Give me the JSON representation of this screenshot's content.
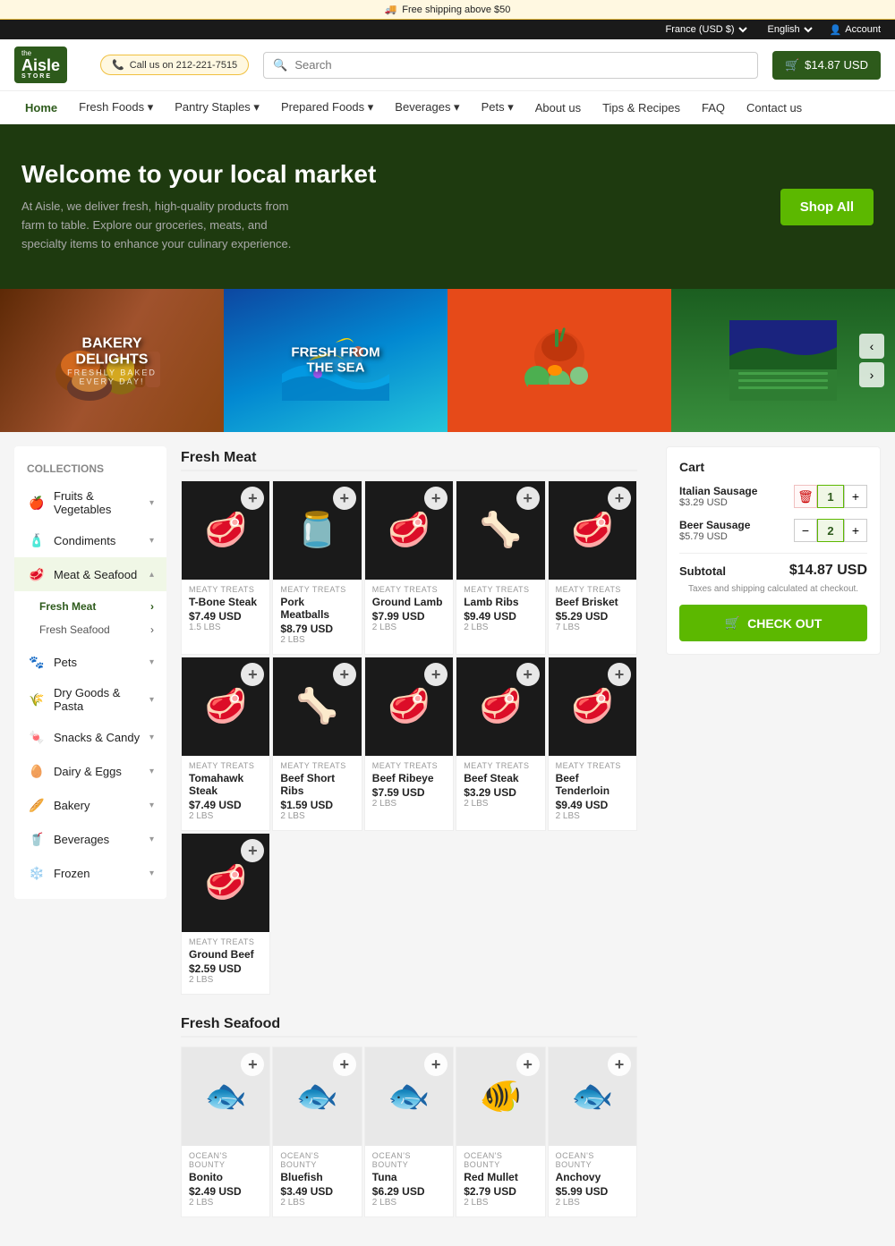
{
  "topbar": {
    "shipping_notice": "Free shipping above $50",
    "region": "France (USD $)",
    "language": "English",
    "account": "Account"
  },
  "header": {
    "logo": "the Aisle STORE",
    "logo_line1": "the",
    "logo_line2": "Aisle",
    "logo_line3": "STORE",
    "phone_label": "Call us on 212-221-7515",
    "search_placeholder": "Search",
    "cart_label": "$14.87 USD"
  },
  "nav": {
    "items": [
      {
        "label": "Home",
        "active": true
      },
      {
        "label": "Fresh Foods",
        "has_dropdown": true
      },
      {
        "label": "Pantry Staples",
        "has_dropdown": true
      },
      {
        "label": "Prepared Foods",
        "has_dropdown": true
      },
      {
        "label": "Beverages",
        "has_dropdown": true
      },
      {
        "label": "Pets",
        "has_dropdown": true
      },
      {
        "label": "About us"
      },
      {
        "label": "Tips & Recipes"
      },
      {
        "label": "FAQ"
      },
      {
        "label": "Contact us"
      }
    ]
  },
  "hero": {
    "title": "Welcome to your local market",
    "description": "At Aisle, we deliver fresh, high-quality products from farm to table. Explore our groceries, meats, and specialty items to enhance your culinary experience.",
    "cta": "Shop All"
  },
  "banners": [
    {
      "label": "BAKERY DELIGHTS",
      "sublabel": "FRESHLY BAKED EVERY DAY!",
      "bg": "#5d2906"
    },
    {
      "label": "FRESH FROM THE SEA",
      "sublabel": "",
      "bg": "#0d47a1"
    },
    {
      "label": "",
      "sublabel": "",
      "bg": "#e64a19"
    },
    {
      "label": "",
      "sublabel": "",
      "bg": "#2e7d32"
    }
  ],
  "sidebar": {
    "title": "Collections",
    "items": [
      {
        "label": "Fruits & Vegetables",
        "icon": "🍎",
        "expanded": false
      },
      {
        "label": "Condiments",
        "icon": "🧴",
        "expanded": false
      },
      {
        "label": "Meat & Seafood",
        "icon": "🥩",
        "expanded": true,
        "active": true,
        "sub": [
          {
            "label": "Fresh Meat",
            "active": true
          },
          {
            "label": "Fresh Seafood",
            "active": false
          }
        ]
      },
      {
        "label": "Pets",
        "icon": "🐾",
        "expanded": false
      },
      {
        "label": "Dry Goods & Pasta",
        "icon": "🌾",
        "expanded": false
      },
      {
        "label": "Snacks & Candy",
        "icon": "🍬",
        "expanded": false
      },
      {
        "label": "Dairy & Eggs",
        "icon": "🥚",
        "expanded": false
      },
      {
        "label": "Bakery",
        "icon": "🥖",
        "expanded": false
      },
      {
        "label": "Beverages",
        "icon": "🥤",
        "expanded": false
      },
      {
        "label": "Frozen",
        "icon": "❄️",
        "expanded": false
      }
    ]
  },
  "sections": {
    "fresh_meat": {
      "title": "Fresh Meat",
      "products": [
        {
          "brand": "MEATY TREATS",
          "name": "T-Bone Steak",
          "price": "$7.49 USD",
          "weight": "1.5 LBS",
          "emoji": "🥩"
        },
        {
          "brand": "MEATY TREATS",
          "name": "Pork Meatballs",
          "price": "$8.79 USD",
          "weight": "2 LBS",
          "emoji": "🫙"
        },
        {
          "brand": "MEATY TREATS",
          "name": "Ground Lamb",
          "price": "$7.99 USD",
          "weight": "2 LBS",
          "emoji": "🥩"
        },
        {
          "brand": "MEATY TREATS",
          "name": "Lamb Ribs",
          "price": "$9.49 USD",
          "weight": "2 LBS",
          "emoji": "🦴"
        },
        {
          "brand": "MEATY TREATS",
          "name": "Beef Brisket",
          "price": "$5.29 USD",
          "weight": "7 LBS",
          "emoji": "🥩"
        },
        {
          "brand": "MEATY TREATS",
          "name": "Tomahawk Steak",
          "price": "$7.49 USD",
          "weight": "2 LBS",
          "emoji": "🥩"
        },
        {
          "brand": "MEATY TREATS",
          "name": "Beef Short Ribs",
          "price": "$1.59 USD",
          "weight": "2 LBS",
          "emoji": "🦴"
        },
        {
          "brand": "MEATY TREATS",
          "name": "Beef Ribeye",
          "price": "$7.59 USD",
          "weight": "2 LBS",
          "emoji": "🥩"
        },
        {
          "brand": "MEATY TREATS",
          "name": "Beef Steak",
          "price": "$3.29 USD",
          "weight": "2 LBS",
          "emoji": "🥩"
        },
        {
          "brand": "MEATY TREATS",
          "name": "Beef Tenderloin",
          "price": "$9.49 USD",
          "weight": "2 LBS",
          "emoji": "🥩"
        },
        {
          "brand": "MEATY TREATS",
          "name": "Ground Beef",
          "price": "$2.59 USD",
          "weight": "2 LBS",
          "emoji": "🥩"
        }
      ]
    },
    "fresh_seafood": {
      "title": "Fresh Seafood",
      "products": [
        {
          "brand": "OCEAN'S BOUNTY",
          "name": "Bonito",
          "price": "$2.49 USD",
          "weight": "2 LBS",
          "emoji": "🐟"
        },
        {
          "brand": "OCEAN'S BOUNTY",
          "name": "Bluefish",
          "price": "$3.49 USD",
          "weight": "2 LBS",
          "emoji": "🐟"
        },
        {
          "brand": "OCEAN'S BOUNTY",
          "name": "Tuna",
          "price": "$6.29 USD",
          "weight": "2 LBS",
          "emoji": "🐟"
        },
        {
          "brand": "OCEAN'S BOUNTY",
          "name": "Red Mullet",
          "price": "$2.79 USD",
          "weight": "2 LBS",
          "emoji": "🐠"
        },
        {
          "brand": "OCEAN'S BOUNTY",
          "name": "Anchovy",
          "price": "$5.99 USD",
          "weight": "2 LBS",
          "emoji": "🐟"
        }
      ]
    }
  },
  "cart": {
    "title": "Cart",
    "items": [
      {
        "name": "Italian Sausage",
        "price": "$3.29 USD",
        "qty": 1
      },
      {
        "name": "Beer Sausage",
        "price": "$5.79 USD",
        "qty": 2
      }
    ],
    "subtotal_label": "Subtotal",
    "subtotal": "$14.87 USD",
    "tax_note": "Taxes and shipping calculated at checkout.",
    "checkout_label": "CHECK OUT"
  }
}
